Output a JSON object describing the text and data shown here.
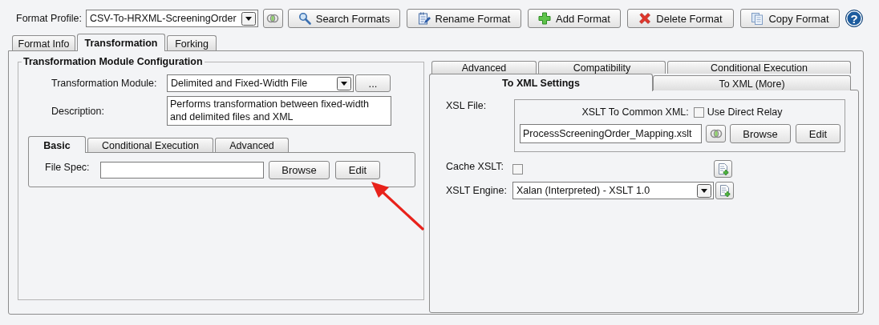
{
  "toolbar": {
    "profile_label": "Format Profile:",
    "profile": "CSV-To-HRXML-ScreeningOrder",
    "buttons": [
      {
        "label": "Search Formats",
        "kind": "search"
      },
      {
        "label": "Rename Format",
        "kind": "rename"
      },
      {
        "label": "Add Format",
        "kind": "add"
      },
      {
        "label": "Delete Format",
        "kind": "delete"
      },
      {
        "label": "Copy Format",
        "kind": "copy"
      }
    ],
    "help": "?"
  },
  "tabs": [
    {
      "label": "Format Info",
      "selected": false
    },
    {
      "label": "Transformation",
      "selected": true
    },
    {
      "label": "Forking",
      "selected": false
    }
  ],
  "module_config": {
    "title": "Transformation Module Configuration",
    "module_label": "Transformation Module:",
    "module": "Delimited and Fixed-Width File",
    "more_button": "...",
    "description_label": "Description:",
    "description": "Performs transformation between fixed-width and delimited files and XML",
    "sub_tabs": [
      {
        "label": "Basic",
        "selected": true
      },
      {
        "label": "Conditional Execution",
        "selected": false
      },
      {
        "label": "Advanced",
        "selected": false
      }
    ],
    "file_spec_label": "File Spec:",
    "file_spec_buttons": [
      "Browse",
      "Edit"
    ]
  },
  "xml_panel": {
    "tabs_back": [
      {
        "label": "Advanced",
        "selected": false
      },
      {
        "label": "Compatibility",
        "selected": false
      },
      {
        "label": "Conditional Execution",
        "selected": false
      }
    ],
    "tabs_front": [
      {
        "label": "To XML Settings",
        "selected": true
      },
      {
        "label": "To XML (More)",
        "selected": false
      }
    ],
    "xsl_file_label": "XSL File:",
    "common_xml_label": "XSLT To Common XML:",
    "use_direct_relay": {
      "label": "Use Direct Relay",
      "checked": false
    },
    "xsl_file": "ProcessScreeningOrder_Mapping.xslt",
    "xsl_buttons": [
      "Browse",
      "Edit"
    ],
    "cache_xslt": {
      "label": "Cache XSLT:",
      "checked": false
    },
    "engine_label": "XSLT Engine:",
    "engine": "Xalan (Interpreted) - XSLT 1.0"
  }
}
